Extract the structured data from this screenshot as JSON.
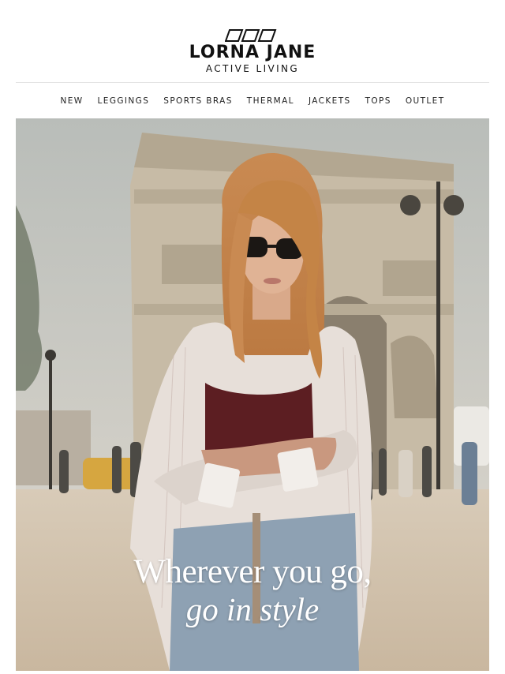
{
  "brand": {
    "name": "LORNA JANE",
    "tagline": "ACTIVE LIVING"
  },
  "nav": {
    "items": [
      {
        "label": "NEW"
      },
      {
        "label": "LEGGINGS"
      },
      {
        "label": "SPORTS BRAS"
      },
      {
        "label": "THERMAL"
      },
      {
        "label": "JACKETS"
      },
      {
        "label": "TOPS"
      },
      {
        "label": "OUTLET"
      }
    ]
  },
  "hero": {
    "headline_line1": "Wherever you go,",
    "headline_line2": "go in style"
  },
  "colors": {
    "text": "#1a1a1a",
    "headline": "#ffffff",
    "divider": "#e3e3e3"
  }
}
